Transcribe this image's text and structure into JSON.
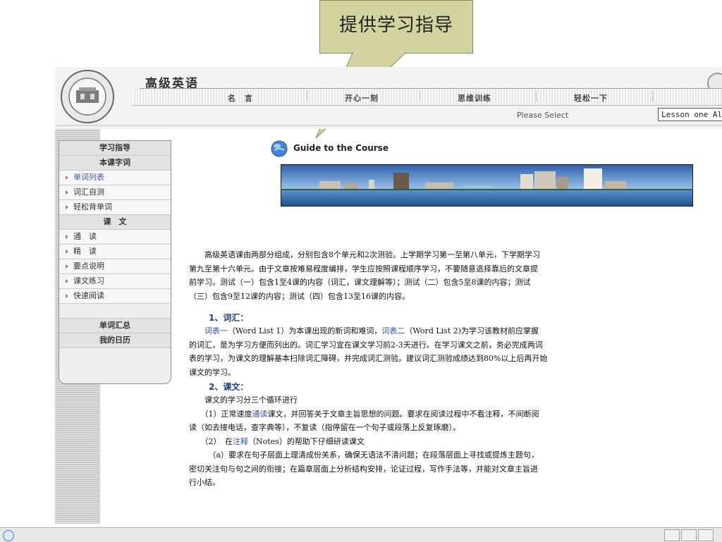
{
  "callout": {
    "text": "提供学习指导"
  },
  "header": {
    "site_title": "高级英语",
    "nav": [
      "名　言",
      "开心一刻",
      "思维训练",
      "轻松一下"
    ],
    "select_label": "Please Select",
    "lesson_value": "Lesson one Alienation an"
  },
  "sidebar": {
    "items": [
      {
        "label": "学习指导",
        "type": "head"
      },
      {
        "label": "本课字词",
        "type": "head"
      },
      {
        "label": "单词列表",
        "type": "sub",
        "active": true
      },
      {
        "label": "词汇自测",
        "type": "sub"
      },
      {
        "label": "轻松背单词",
        "type": "sub"
      },
      {
        "label": "课　文",
        "type": "head"
      },
      {
        "label": "通　读",
        "type": "sub"
      },
      {
        "label": "精　读",
        "type": "sub"
      },
      {
        "label": "要点说明",
        "type": "sub"
      },
      {
        "label": "课文练习",
        "type": "sub"
      },
      {
        "label": "快速阅读",
        "type": "sub"
      },
      {
        "label": "",
        "type": "blank"
      },
      {
        "label": "单词汇总",
        "type": "head"
      },
      {
        "label": "我的日历",
        "type": "head"
      }
    ]
  },
  "content": {
    "guide_title": "Guide to the Course",
    "intro": [
      "　　高级英语课由两部分组成，分别包含8个单元和2次测验。上学期学习第一至第八单元，下学期学习",
      "第九至第十六单元。由于文章按难易程度编排，学生应按照课程顺序学习，不要随意选择靠后的文章提",
      "前学习。测试（一）包含1至4课的内容（词汇，课文理解等）；测试（二）包含5至8课的内容；测试",
      "（三）包含9至12课的内容；测试（四）包含13至16课的内容。"
    ],
    "sec1_title": "1、词汇：",
    "sec1_link1": "词表一",
    "sec1_text1": "（Word List 1）为本课出现的新词和难词，",
    "sec1_link2": "词表二",
    "sec1_text2": "（Word List 2)为学习该教材前应掌握",
    "sec1_lines": [
      "的词汇，是为学习方便而列出的。词汇学习宜在课文学习前2-3天进行。在学习课文之前，务必完成两词",
      "表的学习，为课文的理解基本扫除词汇障碍，并完成词汇测验。建议词汇测验成绩达到80%以上后再开始",
      "课文的学习。"
    ],
    "sec2_title": "2、课文：",
    "sec2_intro": "　　课文的学习分三个循环进行",
    "step1_pre": "　　（1）正常速度",
    "step1_link": "通读",
    "step1_post": "课文，并回答关于文章主旨思想的问题。要求在阅读过程中不看注释，不间断阅",
    "step1_line2": "读（如去接电话，查字典等），不复读（指停留在一个句子或段落上反复琢磨）。",
    "step2_pre": "　　（2）　在",
    "step2_link": "注释",
    "step2_post": "（Notes）的帮助下仔细研读课文",
    "step2a_lines": [
      "　　　（a）要求在句子层面上理清成份关系，确保无语法不清问题；在段落层面上寻找或提炼主题句，",
      "密切关注句与句之间的衔接；在篇章层面上分析结构安排，论证过程，写作手法等，并能对文章主旨进",
      "行小结。"
    ]
  },
  "colors": {
    "callout_bg": "#d3d3a0",
    "link": "#2b55b3",
    "section_head": "#1a3f8a"
  }
}
